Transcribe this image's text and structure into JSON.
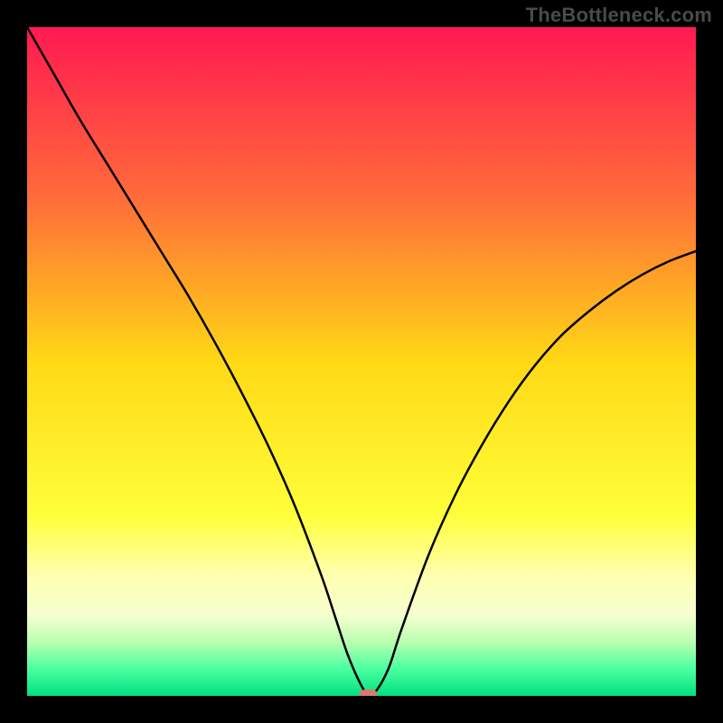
{
  "watermark": "TheBottleneck.com",
  "chart_data": {
    "type": "line",
    "title": "",
    "xlabel": "",
    "ylabel": "",
    "xlim": [
      0,
      100
    ],
    "ylim": [
      0,
      100
    ],
    "background_gradient": {
      "stops": [
        {
          "offset": 0.0,
          "color": "#ff1952"
        },
        {
          "offset": 0.25,
          "color": "#ff6a3a"
        },
        {
          "offset": 0.5,
          "color": "#ffd815"
        },
        {
          "offset": 0.73,
          "color": "#ffff3a"
        },
        {
          "offset": 0.82,
          "color": "#ffffb0"
        },
        {
          "offset": 0.88,
          "color": "#f5ffd0"
        },
        {
          "offset": 0.92,
          "color": "#b8ffb0"
        },
        {
          "offset": 0.96,
          "color": "#4affa0"
        },
        {
          "offset": 1.0,
          "color": "#00e080"
        }
      ]
    },
    "series": [
      {
        "name": "bottleneck-curve",
        "stroke": "#000000",
        "stroke_width": 2.5,
        "x": [
          0,
          4,
          8,
          12,
          16,
          20,
          24,
          28,
          32,
          36,
          40,
          44,
          46,
          48,
          50,
          51,
          52,
          54,
          56,
          60,
          64,
          68,
          72,
          76,
          80,
          84,
          88,
          92,
          96,
          100
        ],
        "y": [
          100,
          93,
          86,
          79.5,
          73,
          66.5,
          60,
          53,
          45.5,
          37.5,
          28.5,
          18,
          12,
          6,
          1.5,
          0.3,
          0.5,
          4,
          10,
          21,
          30,
          37.5,
          44,
          49.5,
          54,
          57.5,
          60.5,
          63,
          65,
          66.5
        ]
      }
    ],
    "marker": {
      "name": "optimal-point",
      "x": 51,
      "y": 0.3,
      "rx": 1.4,
      "ry": 0.7,
      "fill": "#d97a6f"
    }
  }
}
